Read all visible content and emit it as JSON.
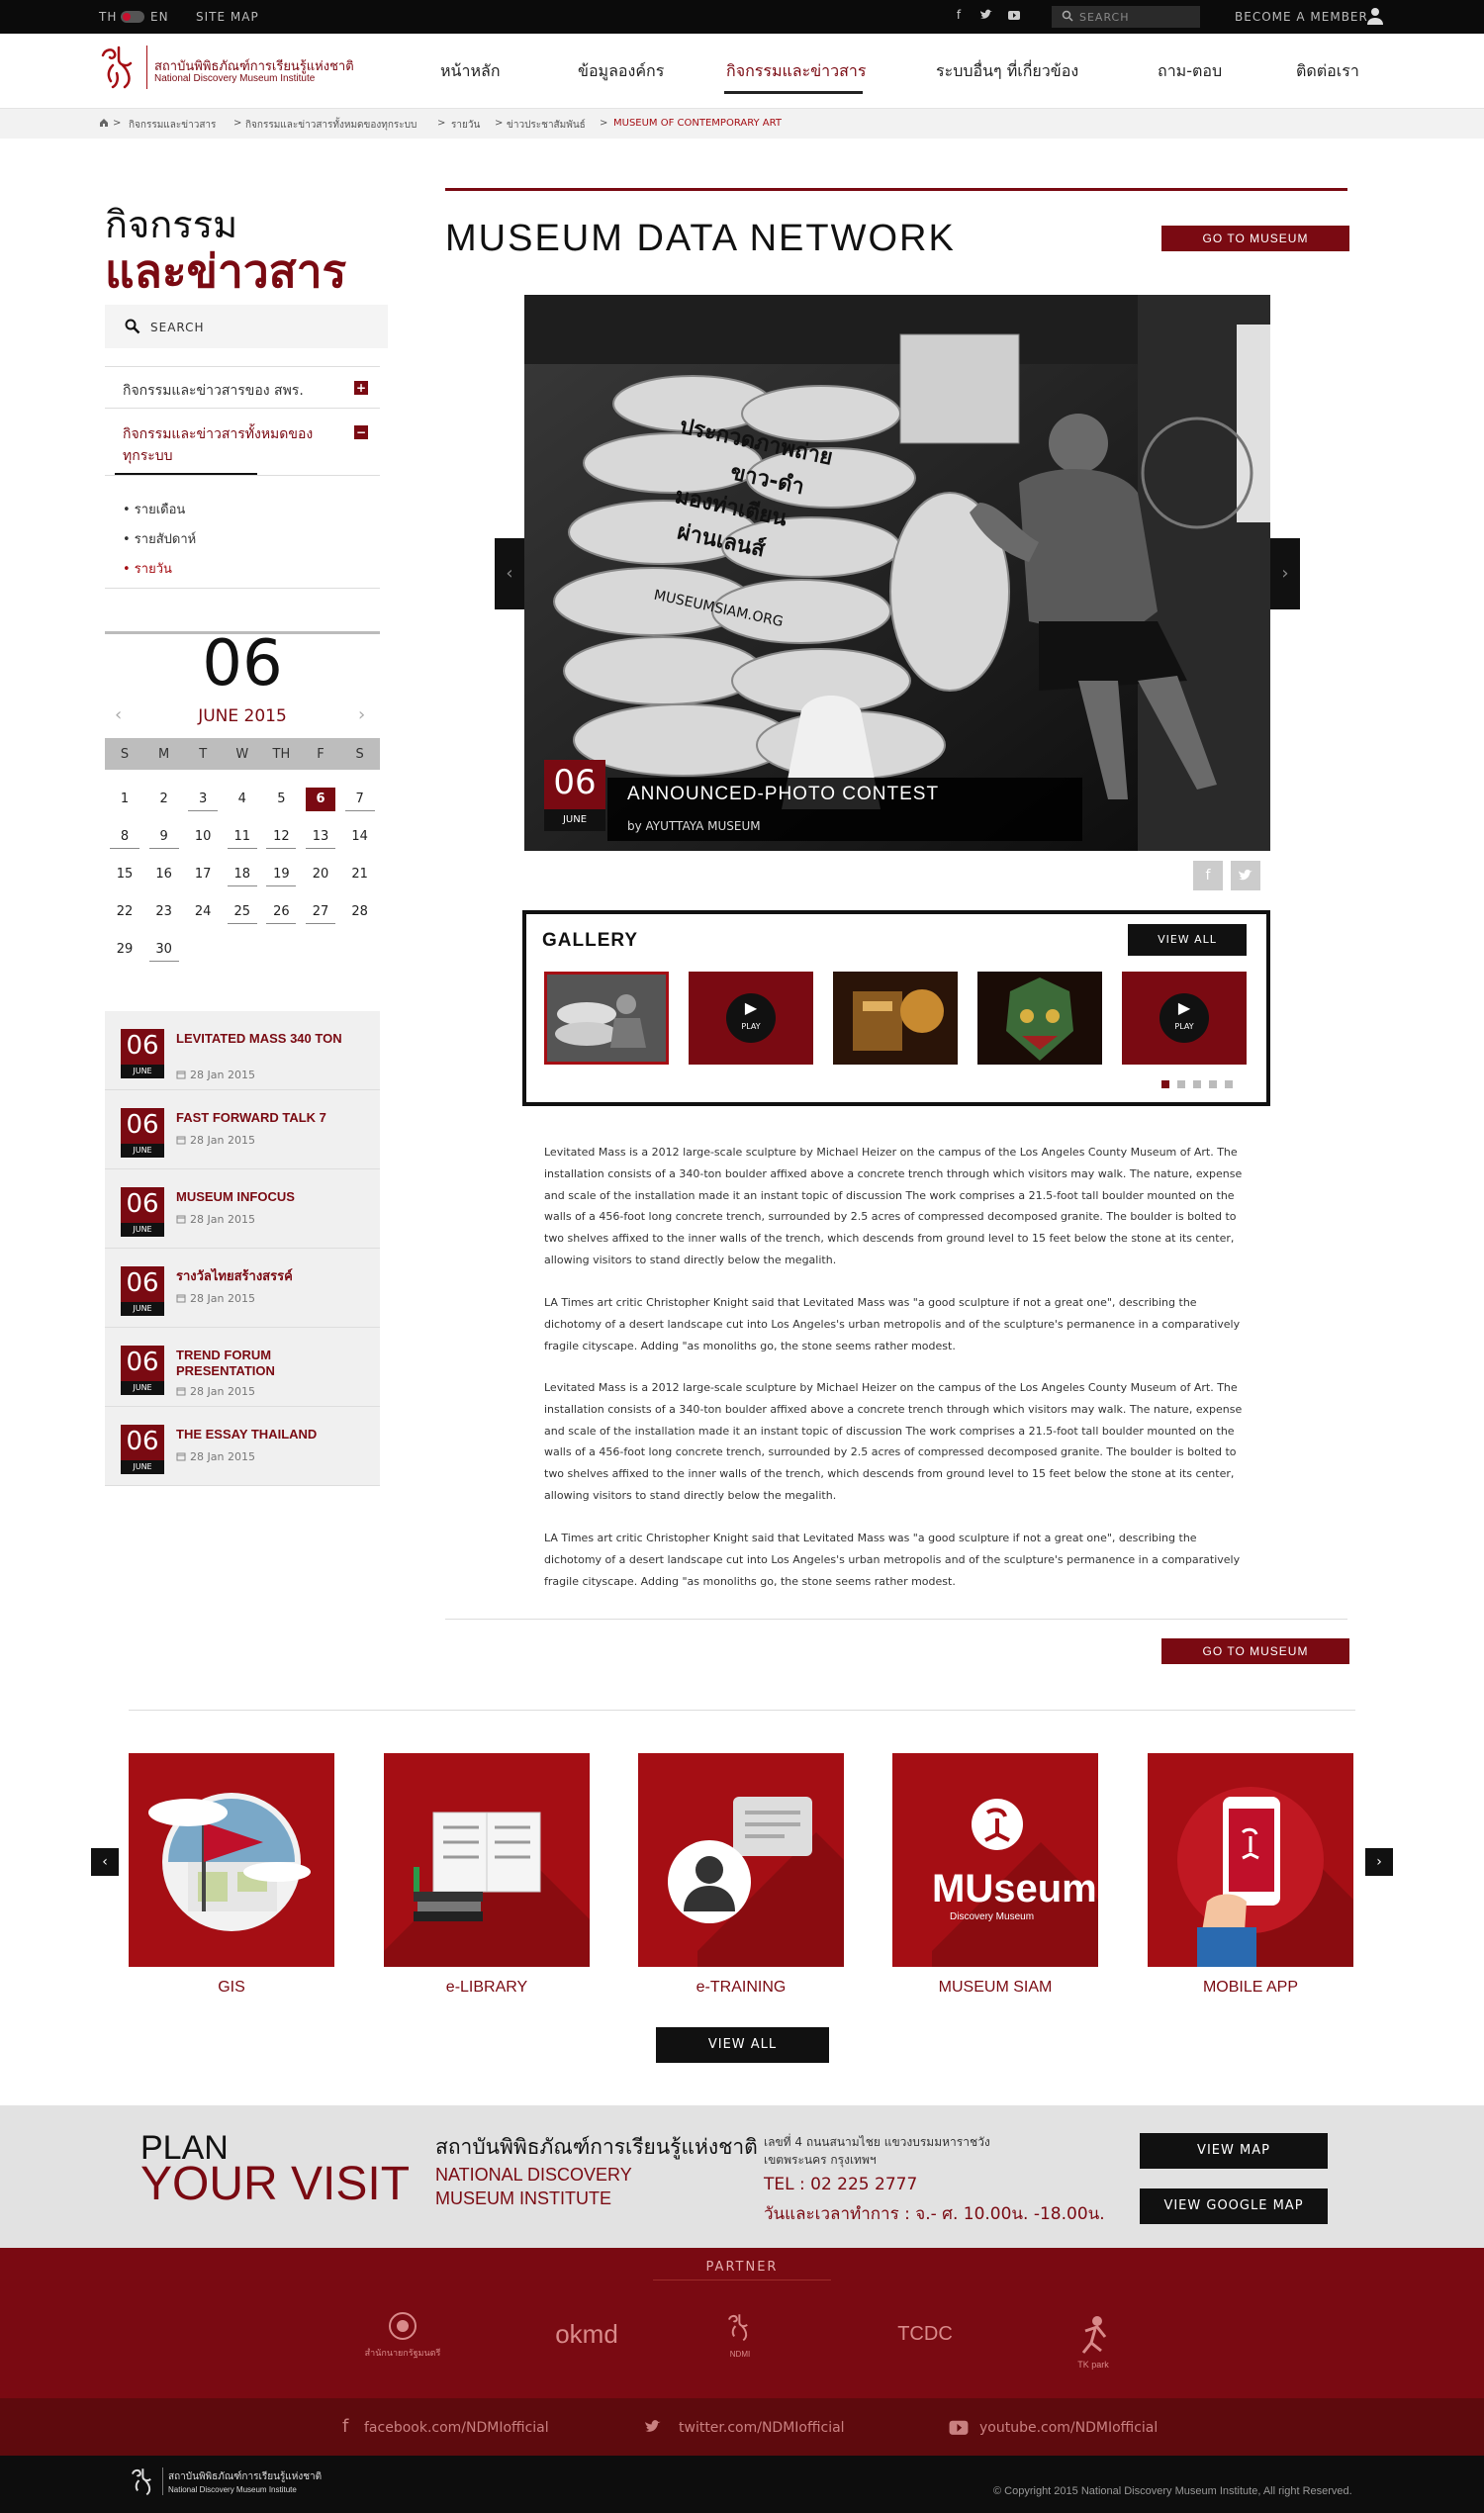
{
  "topbar": {
    "lang_th": "TH",
    "lang_en": "EN",
    "sitemap": "SITE MAP",
    "search_placeholder": "SEARCH",
    "member": "BECOME A MEMBER",
    "social_icons": [
      "facebook-icon",
      "twitter-icon",
      "youtube-icon"
    ]
  },
  "brand": {
    "name_th": "สถาบันพิพิธภัณฑ์การเรียนรู้แห่งชาติ",
    "name_en": "National Discovery Museum Institute"
  },
  "nav": [
    "หน้าหลัก",
    "ข้อมูลองค์กร",
    "กิจกรรมและข่าวสาร",
    "ระบบอื่นๆ ที่เกี่ยวข้อง",
    "ถาม-ตอบ",
    "ติดต่อเรา"
  ],
  "breadcrumb": [
    "กิจกรรมและข่าวสาร",
    "กิจกรรมและข่าวสารทั้งหมดของทุกระบบ",
    "รายวัน",
    "ข่าวประชาสัมพันธ์",
    "MUSEUM OF CONTEMPORARY ART"
  ],
  "sidebar": {
    "title1": "กิจกรรม",
    "title2": "และข่าวสาร",
    "search": "SEARCH",
    "menu1": "กิจกรรมและข่าวสารของ สพร.",
    "menu2a": "กิจกรรมและข่าวสารทั้งหมดของ",
    "menu2b": "ทุกระบบ",
    "sub": [
      "• รายเดือน",
      "• รายสัปดาห์",
      "• รายวัน"
    ]
  },
  "calendar": {
    "big_day": "06",
    "month": "JUNE 2015",
    "days_header": [
      "S",
      "M",
      "T",
      "W",
      "TH",
      "F",
      "S"
    ],
    "weeks": [
      [
        "1",
        "2",
        "3",
        "4",
        "5",
        "6",
        "7"
      ],
      [
        "8",
        "9",
        "10",
        "11",
        "12",
        "13",
        "14"
      ],
      [
        "15",
        "16",
        "17",
        "18",
        "19",
        "20",
        "21"
      ],
      [
        "22",
        "23",
        "24",
        "25",
        "26",
        "27",
        "28"
      ],
      [
        "29",
        "30"
      ]
    ],
    "selected": "6"
  },
  "events": [
    {
      "day": "06",
      "month": "JUNE",
      "title": "LEVITATED MASS 340 TON",
      "date": "28 Jan 2015"
    },
    {
      "day": "06",
      "month": "JUNE",
      "title": "FAST FORWARD TALK 7",
      "date": "28 Jan 2015"
    },
    {
      "day": "06",
      "month": "JUNE",
      "title": "MUSEUM INFOCUS",
      "date": "28 Jan 2015"
    },
    {
      "day": "06",
      "month": "JUNE",
      "title": "รางวัลไทยสร้างสรรค์",
      "date": "28 Jan 2015"
    },
    {
      "day": "06",
      "month": "JUNE",
      "title": "TREND FORUM PRESENTATION",
      "date": "28 Jan 2015"
    },
    {
      "day": "06",
      "month": "JUNE",
      "title": "THE ESSAY THAILAND",
      "date": "28 Jan 2015"
    }
  ],
  "main": {
    "title": "MUSEUM DATA NETWORK",
    "go_button": "GO TO MUSEUM",
    "slide": {
      "day": "06",
      "month": "JUNE",
      "title": "ANNOUNCED-PHOTO CONTEST",
      "by": "by AYUTTAYA MUSEUM",
      "sign_lines": [
        "ประกวดภาพถ่าย",
        "ขาว-ดำ",
        "มองท่าเตียน",
        "ผ่านเลนส์"
      ],
      "bag_text": "MUSEUMSIAM.ORG"
    },
    "gallery": {
      "title": "GALLERY",
      "view_all": "VIEW ALL",
      "play": "PLAY"
    },
    "paragraphs": [
      "Levitated Mass is a 2012 large-scale sculpture by Michael Heizer on the campus of the Los Angeles County Museum of Art. The installation consists of a 340-ton boulder affixed above a concrete trench through which visitors may walk. The nature, expense and scale of the installation made it an instant topic of discussion The work comprises a 21.5-foot tall boulder mounted on the walls of a 456-foot long concrete trench, surrounded by 2.5 acres of compressed decomposed granite. The boulder is bolted to two shelves affixed to the inner walls of the trench, which descends from ground level to 15 feet below the stone at its center, allowing visitors to stand directly below the megalith.",
      "LA Times art critic Christopher Knight said that Levitated Mass was \"a good sculpture if not a great one\", describing the dichotomy of a desert landscape cut into Los Angeles's urban metropolis and of the sculpture's permanence in a comparatively fragile cityscape. Adding \"as monoliths go, the stone seems rather modest.",
      "Levitated Mass is a 2012 large-scale sculpture by Michael Heizer on the campus of the Los Angeles County Museum of Art. The installation consists of a 340-ton boulder affixed above a concrete trench through which visitors may walk. The nature, expense and scale of the installation made it an instant topic of discussion The work comprises a 21.5-foot tall boulder mounted on the walls of a 456-foot long concrete trench, surrounded by 2.5 acres of compressed decomposed granite. The boulder is bolted to two shelves affixed to the inner walls of the trench, which descends from ground level to 15 feet below the stone at its center, allowing visitors to stand directly below the megalith.",
      "LA Times art critic Christopher Knight said that Levitated Mass was \"a good sculpture if not a great one\", describing the dichotomy of a desert landscape cut into Los Angeles's urban metropolis and of the sculpture's permanence in a comparatively fragile cityscape. Adding \"as monoliths go, the stone seems rather modest."
    ]
  },
  "quicklinks": {
    "items": [
      "GIS",
      "e-LIBRARY",
      "e-TRAINING",
      "MUSEUM SIAM",
      "MOBILE APP"
    ],
    "view_all": "VIEW ALL",
    "museum_siam_logo": "MUseum Siam",
    "museum_siam_sub": "Discovery Museum"
  },
  "plan": {
    "line1": "PLAN",
    "line2": "YOUR VISIT",
    "name_th": "สถาบันพิพิธภัณฑ์การเรียนรู้แห่งชาติ",
    "name_en": "NATIONAL DISCOVERY MUSEUM INSTITUTE",
    "addr1": "เลขที่ 4 ถนนสนามไชย แขวงบรมมหาราชวัง",
    "addr2": "เขตพระนคร กรุงเทพฯ",
    "tel": "TEL : 02 225 2777",
    "hours": "วันและเวลาทำการ : จ.- ศ. 10.00น. -18.00น.",
    "view_map": "VIEW MAP",
    "view_google_map": "VIEW GOOGLE MAP"
  },
  "partner": {
    "title": "PARTNER",
    "logo1_caption": "สำนักนายกรัฐมนตรี",
    "logo2": "okmd",
    "logo3_caption": "NDMI",
    "logo4": "TCDC",
    "logo5": "TK park"
  },
  "social": [
    "facebook.com/NDMIofficial",
    "twitter.com/NDMIofficial",
    "youtube.com/NDMIofficial"
  ],
  "footer": {
    "name_th": "สถาบันพิพิธภัณฑ์การเรียนรู้แห่งชาติ",
    "name_en": "National Discovery Museum Institute",
    "copyright": "© Copyright 2015 National Discovery Museum Institute, All right Reserved."
  },
  "colors": {
    "brand": "#7a0a12",
    "quicklink_red": "#a50e14",
    "topbar": "#0b0b0b"
  }
}
